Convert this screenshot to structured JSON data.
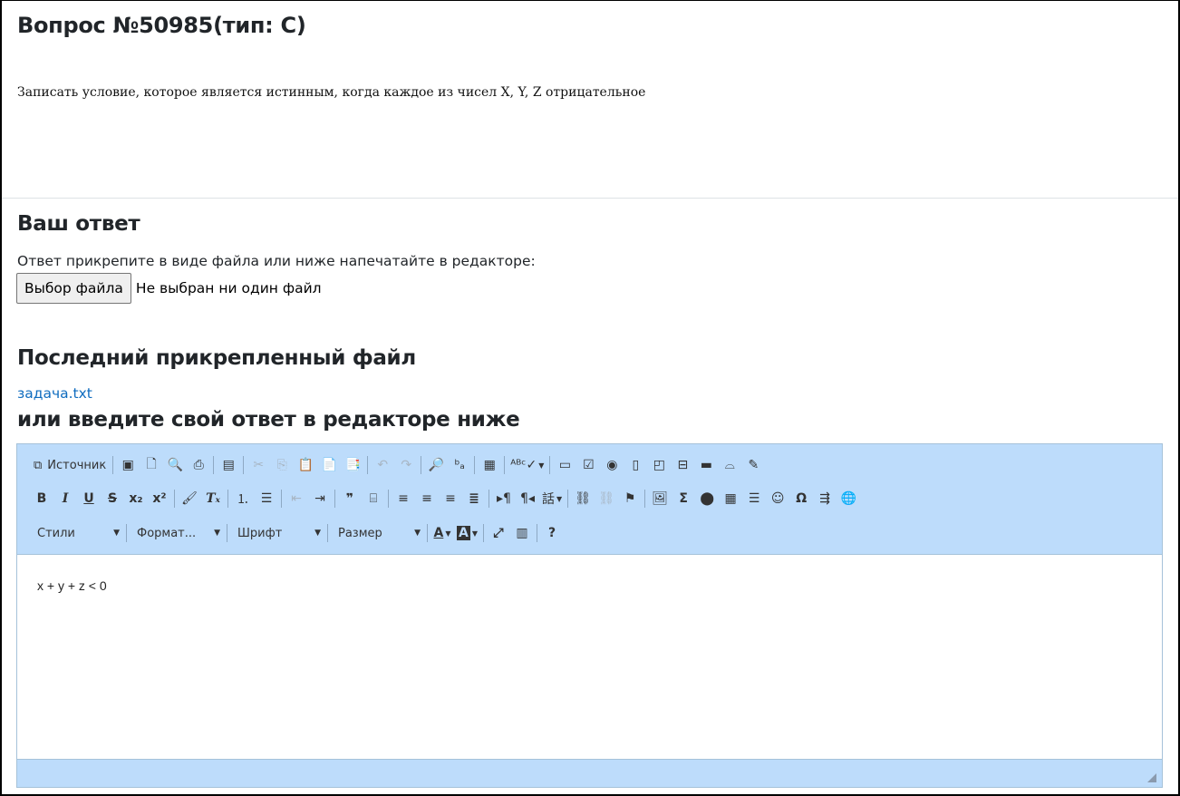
{
  "question": {
    "title": "Вопрос №50985(тип: С)",
    "text": "Записать условие, которое является истинным, когда каждое из чисел X, Y, Z отрицательное"
  },
  "answer": {
    "heading": "Ваш ответ",
    "instruction": "Ответ прикрепите в виде файла или ниже напечатайте в редакторе:",
    "file_button": "Выбор файла",
    "file_status": "Не выбран ни один файл"
  },
  "last_file": {
    "heading": "Последний прикрепленный файл",
    "link": "задача.txt"
  },
  "editor": {
    "heading": "или введите свой ответ в редакторе ниже",
    "source_label": "Источник",
    "combos": {
      "styles": "Стили",
      "format": "Формат...",
      "font": "Шрифт",
      "size": "Размер"
    },
    "content": "x + y + z < 0"
  },
  "colors": {
    "toolbar_bg": "#bddcfb",
    "link": "#0f6cbf"
  }
}
